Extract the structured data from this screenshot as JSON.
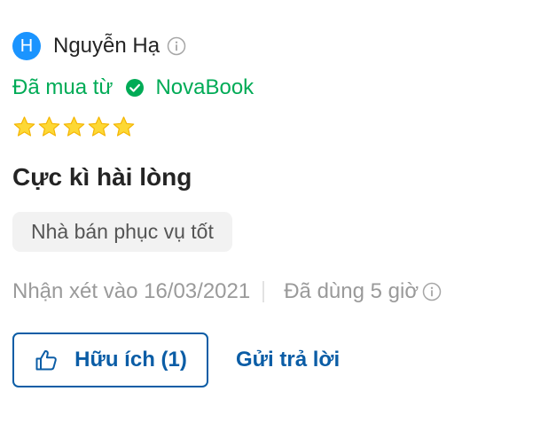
{
  "reviewer": {
    "avatar_letter": "H",
    "name": "Nguyễn Hạ"
  },
  "purchase": {
    "prefix": "Đã mua từ",
    "seller": "NovaBook"
  },
  "rating": {
    "stars": 5,
    "max_stars": 5
  },
  "review": {
    "title": "Cực kì hài lòng",
    "tag": "Nhà bán phục vụ tốt"
  },
  "meta": {
    "review_date": "Nhận xét vào 16/03/2021",
    "usage": "Đã dùng 5 giờ"
  },
  "actions": {
    "helpful_label": "Hữu ích (1)",
    "reply_label": "Gửi trả lời"
  },
  "colors": {
    "avatar": "#1a94ff",
    "purchase_green": "#00ab56",
    "star": "#fdd835",
    "action_blue": "#0b5da6"
  },
  "icons": {
    "info": "info-circle-icon",
    "check": "check-circle-icon",
    "star": "star-icon",
    "thumb": "thumbs-up-icon"
  }
}
